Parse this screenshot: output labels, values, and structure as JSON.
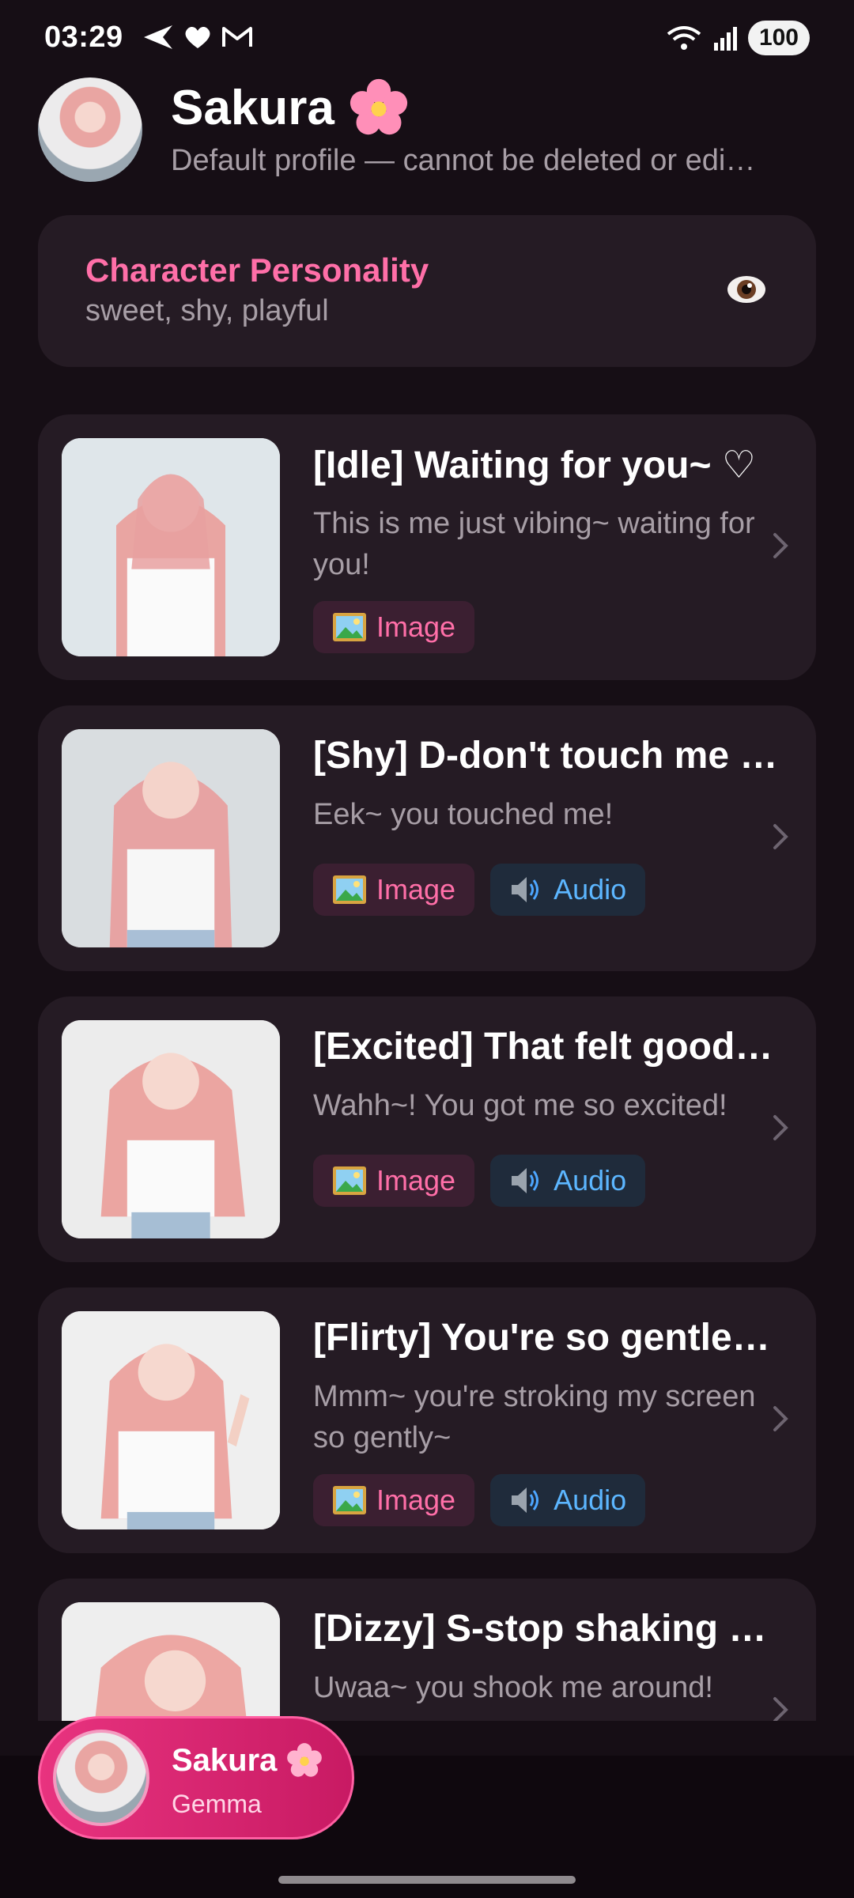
{
  "status_bar": {
    "time": "03:29",
    "battery": "100"
  },
  "header": {
    "name": "Sakura",
    "subtitle": "Default profile — cannot be deleted or edi…"
  },
  "personality": {
    "title": "Character Personality",
    "value": "sweet, shy, playful"
  },
  "states": [
    {
      "title": "[Idle] Waiting for you~ ♡",
      "description": "This is me just vibing~ waiting for you!",
      "badges": [
        "Image"
      ]
    },
    {
      "title": "[Shy] D-don't touch me t…",
      "description": "Eek~ you touched me!",
      "badges": [
        "Image",
        "Audio"
      ]
    },
    {
      "title": "[Excited] That felt good…",
      "description": "Wahh~! You got me so excited!",
      "badges": [
        "Image",
        "Audio"
      ]
    },
    {
      "title": "[Flirty] You're so gentle…",
      "description": "Mmm~ you're stroking my screen so gently~",
      "badges": [
        "Image",
        "Audio"
      ]
    },
    {
      "title": "[Dizzy] S-stop shaking …",
      "description": "Uwaa~ you shook me around!",
      "badges": []
    }
  ],
  "badge_labels": {
    "image": "Image",
    "audio": "Audio"
  },
  "active_character": {
    "name": "Sakura",
    "model": "Gemma"
  },
  "colors": {
    "accent_pink": "#ff6fa8",
    "audio_blue": "#5cb6ff",
    "background": "#160e15",
    "card": "#251b24"
  }
}
